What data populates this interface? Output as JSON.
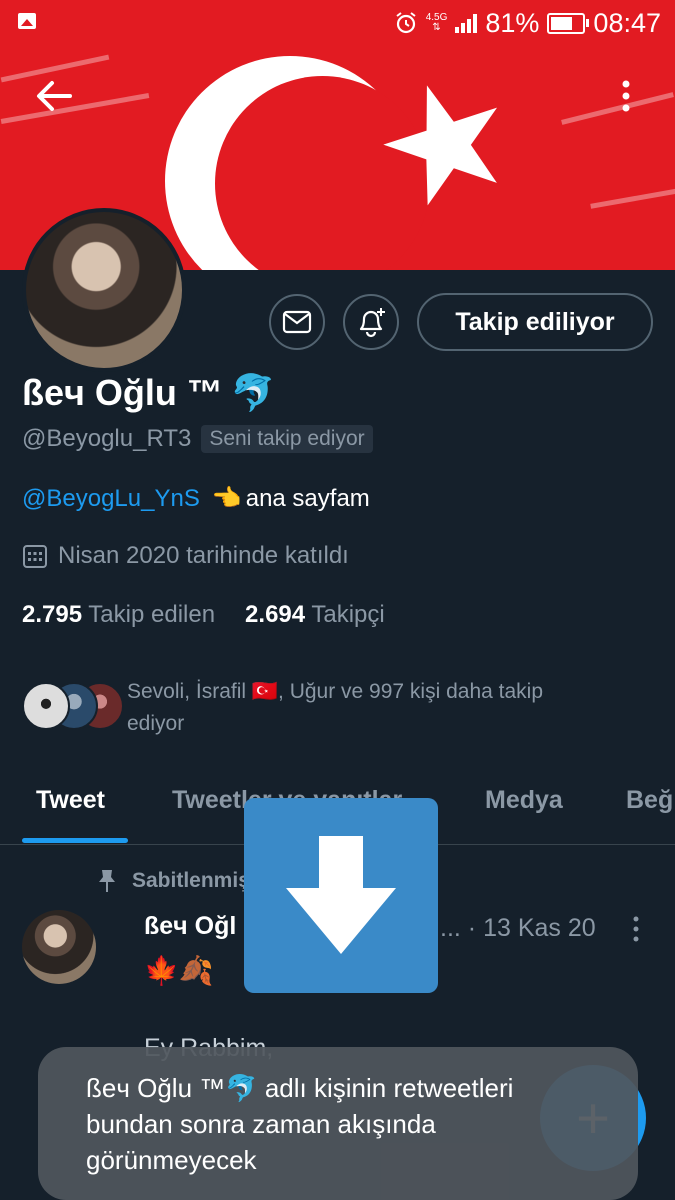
{
  "status_bar": {
    "network": "4.5G",
    "battery_percent": "81%",
    "battery_level": 0.81,
    "time": "08:47",
    "icons": [
      "image-icon",
      "alarm-icon",
      "signal-icon",
      "battery-icon"
    ]
  },
  "header": {
    "back_icon": "arrow-left-icon",
    "menu_icon": "vertical-dots-icon"
  },
  "profile": {
    "name": "ßeч Oğlu ™",
    "name_emoji": "🐬",
    "handle": "@Beyoglu_RT3",
    "follows_you_badge": "Seni takip ediyor",
    "bio_link": "@BeyogLu_YnS",
    "bio_emoji": "👈",
    "bio_text": "ana sayfam",
    "joined": "Nisan 2020 tarihinde katıldı",
    "following_count": "2.795",
    "following_label": "Takip edilen",
    "followers_count": "2.694",
    "followers_label": "Takipçi",
    "known_followers_line1": "Sevoli, İsrafil 🇹🇷, Uğur ve 997 kişi daha takip",
    "known_followers_line2": "ediyor"
  },
  "actions": {
    "follow_button": "Takip ediliyor",
    "message_icon": "mail-icon",
    "notify_icon": "bell-plus-icon"
  },
  "tabs": [
    "Tweet",
    "Tweetler ve yanıtlar",
    "Medya",
    "Beğ"
  ],
  "active_tab": "Tweet",
  "tweet": {
    "pinned_label": "Sabitlenmiş",
    "author": "ßeч Oğl",
    "ellipsis": "...",
    "date": "· 13 Kas 20",
    "leaves": "🍁🍂",
    "body_line1": "Ey Rabbim,"
  },
  "toast": {
    "text": "ßeч Oğlu ™🐬 adlı kişinin retweetleri bundan sonra zaman akışında görünmeyecek"
  },
  "fab_label": "+",
  "colors": {
    "background": "#15202b",
    "accent": "#1d9bf0",
    "banner_red": "#e21b22",
    "muted": "#8b98a5"
  }
}
